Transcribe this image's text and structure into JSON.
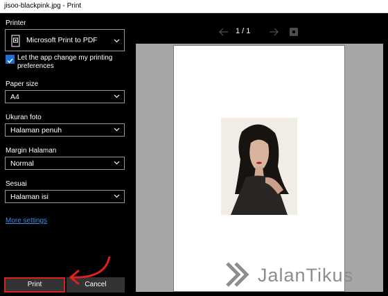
{
  "window": {
    "title": "jisoo-blackpink.jpg - Print"
  },
  "printer": {
    "label": "Printer",
    "value": "Microsoft Print to PDF"
  },
  "app_change": {
    "checked": true,
    "line1": "Let the app change my printing",
    "line2": "preferences"
  },
  "paper_size": {
    "label": "Paper size",
    "value": "A4"
  },
  "photo_size": {
    "label": "Ukuran foto",
    "value": "Halaman penuh"
  },
  "margin": {
    "label": "Margin Halaman",
    "value": "Normal"
  },
  "fit": {
    "label": "Sesuai",
    "value": "Halaman isi"
  },
  "more_settings": "More settings",
  "buttons": {
    "print": "Print",
    "cancel": "Cancel"
  },
  "preview": {
    "page_indicator": "1 / 1"
  },
  "watermark": {
    "text": "JalanTikus"
  },
  "colors": {
    "accent": "#1e6fd0",
    "link": "#3b8eea",
    "highlight": "#e0201e",
    "preview_bg": "#a6a6a6"
  },
  "icons": [
    "printer-icon",
    "checkbox-checked-icon",
    "chevron-down-icon",
    "arrow-left-icon",
    "arrow-right-icon",
    "fit-page-icon"
  ]
}
